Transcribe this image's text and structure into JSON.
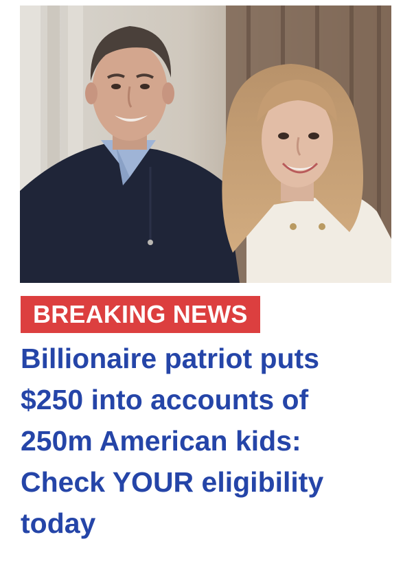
{
  "ad": {
    "image": {
      "alt": "Smiling man in a navy zip sweater and woman with long blonde hair in a white top"
    },
    "badge": "BREAKING NEWS",
    "headline_lines": [
      "Billionaire patriot puts",
      "$250 into accounts of",
      "250m American kids:",
      "Check YOUR eligibility",
      "today"
    ]
  },
  "colors": {
    "badge_background": "#dc3f3f",
    "headline_text": "#2545a8",
    "page_background": "#ffffff"
  }
}
